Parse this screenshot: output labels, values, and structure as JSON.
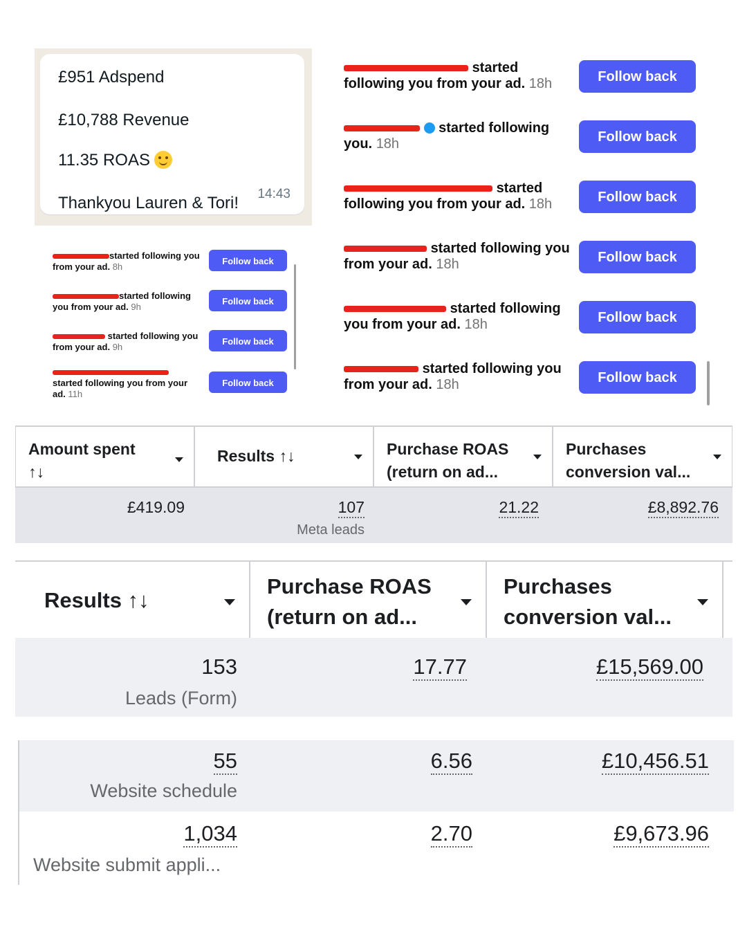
{
  "whatsapp": {
    "adspend": "£951 Adspend",
    "revenue": "£10,788 Revenue",
    "roas": "11.35 ROAS",
    "thanks": "Thankyou Lauren & Tori!",
    "time": "14:43",
    "emoji_icon": "smiling-face-emoji"
  },
  "follow_small": [
    {
      "text": "started following you from your ad.",
      "time": "8h",
      "button": "Follow back"
    },
    {
      "text": "started following you from your ad.",
      "time": "9h",
      "button": "Follow back"
    },
    {
      "text": "started following you from your ad.",
      "time": "9h",
      "button": "Follow back"
    },
    {
      "text": "started following you from your ad.",
      "time": "11h",
      "button": "Follow back"
    }
  ],
  "follow_large": [
    {
      "text": "started following you from your ad.",
      "time": "18h",
      "button": "Follow back"
    },
    {
      "text": "started following you.",
      "time": "18h",
      "button": "Follow back"
    },
    {
      "text": "started following you from your ad.",
      "time": "18h",
      "button": "Follow back"
    },
    {
      "text": "started following you from your ad.",
      "time": "18h",
      "button": "Follow back"
    },
    {
      "text": "started following you from your ad.",
      "time": "18h",
      "button": "Follow back"
    },
    {
      "text": "started following you from your ad.",
      "time": "18h",
      "button": "Follow back"
    }
  ],
  "table1": {
    "headers": [
      "Amount spent ↑↓",
      "Results ↑↓",
      "Purchase ROAS (return on ad...",
      "Purchases conversion val..."
    ],
    "amount_spent": "£419.09",
    "results": "107",
    "results_type": "Meta leads",
    "roas": "21.22",
    "conversion_value": "£8,892.76"
  },
  "table2": {
    "headers": [
      "Results ↑↓",
      "Purchase ROAS (return on ad...",
      "Purchases conversion val..."
    ],
    "rows": [
      {
        "results": "153",
        "type": "Leads (Form)",
        "roas": "17.77",
        "value": "£15,569.00"
      },
      {
        "results": "55",
        "type": "Website schedule",
        "roas": "6.56",
        "value": "£10,456.51"
      },
      {
        "results": "1,034",
        "type": "Website submit appli...",
        "roas": "2.70",
        "value": "£9,673.96"
      }
    ]
  },
  "colors": {
    "follow_button": "#4f5bf5",
    "redaction": "#e8231c",
    "link": "#1b74e4",
    "row_bg": "#e4e6eb"
  }
}
